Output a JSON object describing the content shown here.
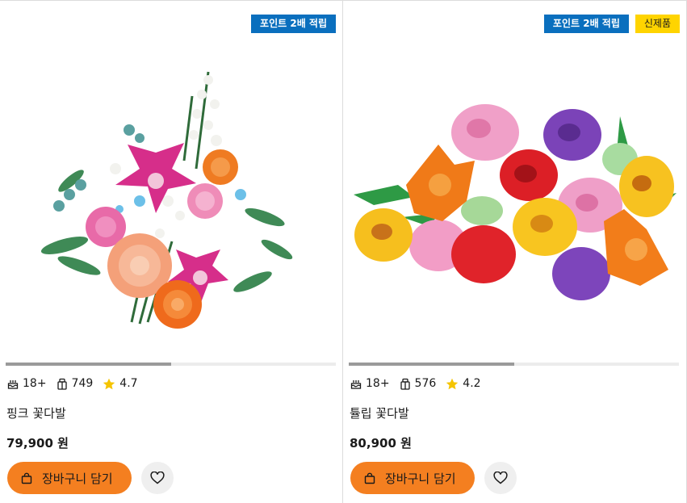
{
  "products": [
    {
      "badges": [
        "포인트 2배 적립"
      ],
      "image": "flower-bouquet-image",
      "progress": 0.5,
      "age": "18+",
      "pieces": "749",
      "rating": "4.7",
      "name": "핑크 꽃다발",
      "price": "79,900 원",
      "cart_label": "장바구니 담기"
    },
    {
      "badges": [
        "포인트 2배 적립",
        "신제품"
      ],
      "image": "tulip-bouquet-image",
      "progress": 0.5,
      "age": "18+",
      "pieces": "576",
      "rating": "4.2",
      "name": "튤립 꽃다발",
      "price": "80,900 원",
      "cart_label": "장바구니 담기"
    }
  ],
  "icons": {
    "age": "cake-icon",
    "pieces": "brick-icon",
    "rating": "star-icon",
    "cart": "shopping-bag-icon",
    "wishlist": "heart-icon"
  },
  "colors": {
    "badge_blue": "#0a6fbe",
    "badge_yellow": "#ffd400",
    "cart_button": "#f47f20",
    "star": "#f5c400",
    "wish_button_bg": "#efefef"
  }
}
